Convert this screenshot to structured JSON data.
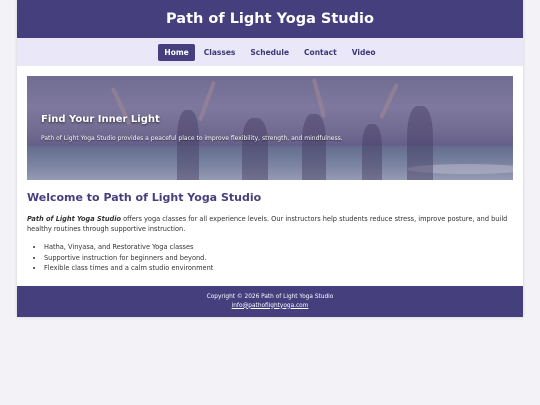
{
  "site": {
    "title": "Path of Light Yoga Studio"
  },
  "nav": {
    "items": [
      {
        "label": "Home",
        "active": true
      },
      {
        "label": "Classes"
      },
      {
        "label": "Schedule"
      },
      {
        "label": "Contact"
      },
      {
        "label": "Video"
      }
    ]
  },
  "hero": {
    "heading": "Find Your Inner Light",
    "text": "Path of Light Yoga Studio provides a peaceful place to improve flexibility, strength, and mindfulness."
  },
  "main": {
    "heading": "Welcome to Path of Light Yoga Studio",
    "intro_studio": "Path of Light Yoga Studio",
    "intro_rest": " offers yoga classes for all experience levels. Our instructors help students reduce stress, improve posture, and build healthy routines through supportive instruction.",
    "features": [
      "Hatha, Vinyasa, and Restorative Yoga classes",
      "Supportive instruction for beginners and beyond.",
      "Flexible class times and a calm studio environment"
    ]
  },
  "footer": {
    "copyright": "Copyright © 2026 Path of Light Yoga Studio",
    "email": "info@pathoflightyoga.com"
  },
  "colors": {
    "primary": "#463f7e",
    "nav_bg": "#e9e7f8",
    "page_bg": "#f3f2f7"
  }
}
